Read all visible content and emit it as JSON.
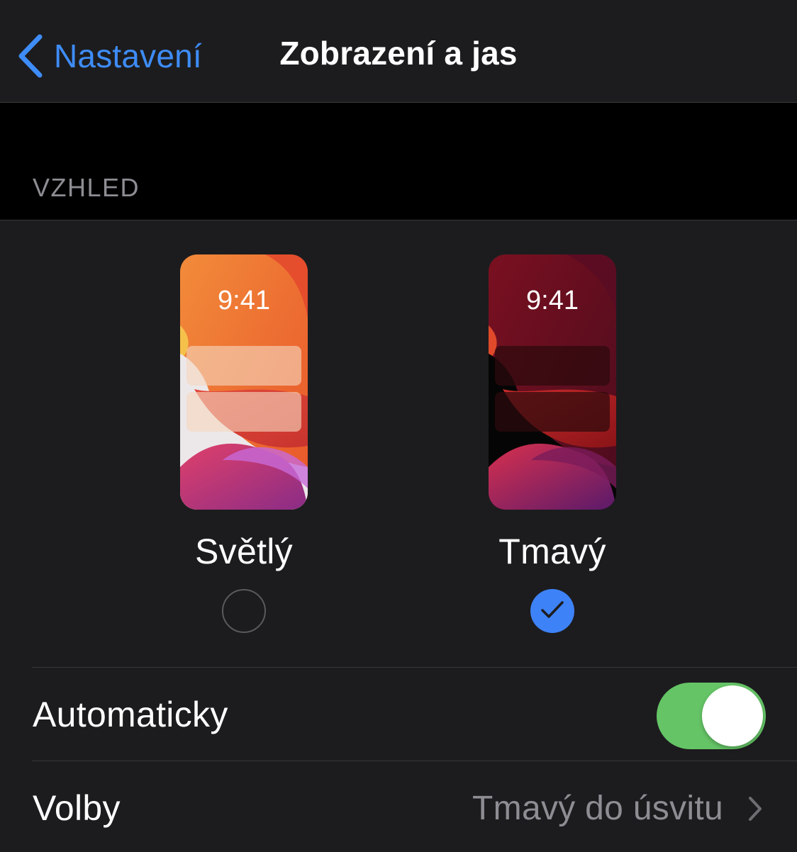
{
  "nav": {
    "back_label": "Nastavení",
    "title": "Zobrazení a jas"
  },
  "appearance": {
    "section_header": "VZHLED",
    "options": [
      {
        "label": "Světlý",
        "preview_time": "9:41",
        "selected": false
      },
      {
        "label": "Tmavý",
        "preview_time": "9:41",
        "selected": true
      }
    ]
  },
  "automatic": {
    "label": "Automaticky",
    "enabled": true
  },
  "options_row": {
    "label": "Volby",
    "value": "Tmavý do úsvitu"
  },
  "colors": {
    "accent": "#3e82f7",
    "toggle_on": "#65c466",
    "background": "#000000",
    "cell_background": "#1c1c1e",
    "secondary_text": "#8d8d93"
  },
  "icons": {
    "back": "chevron-left-icon",
    "disclosure": "chevron-right-icon",
    "selected": "checkmark-icon"
  }
}
